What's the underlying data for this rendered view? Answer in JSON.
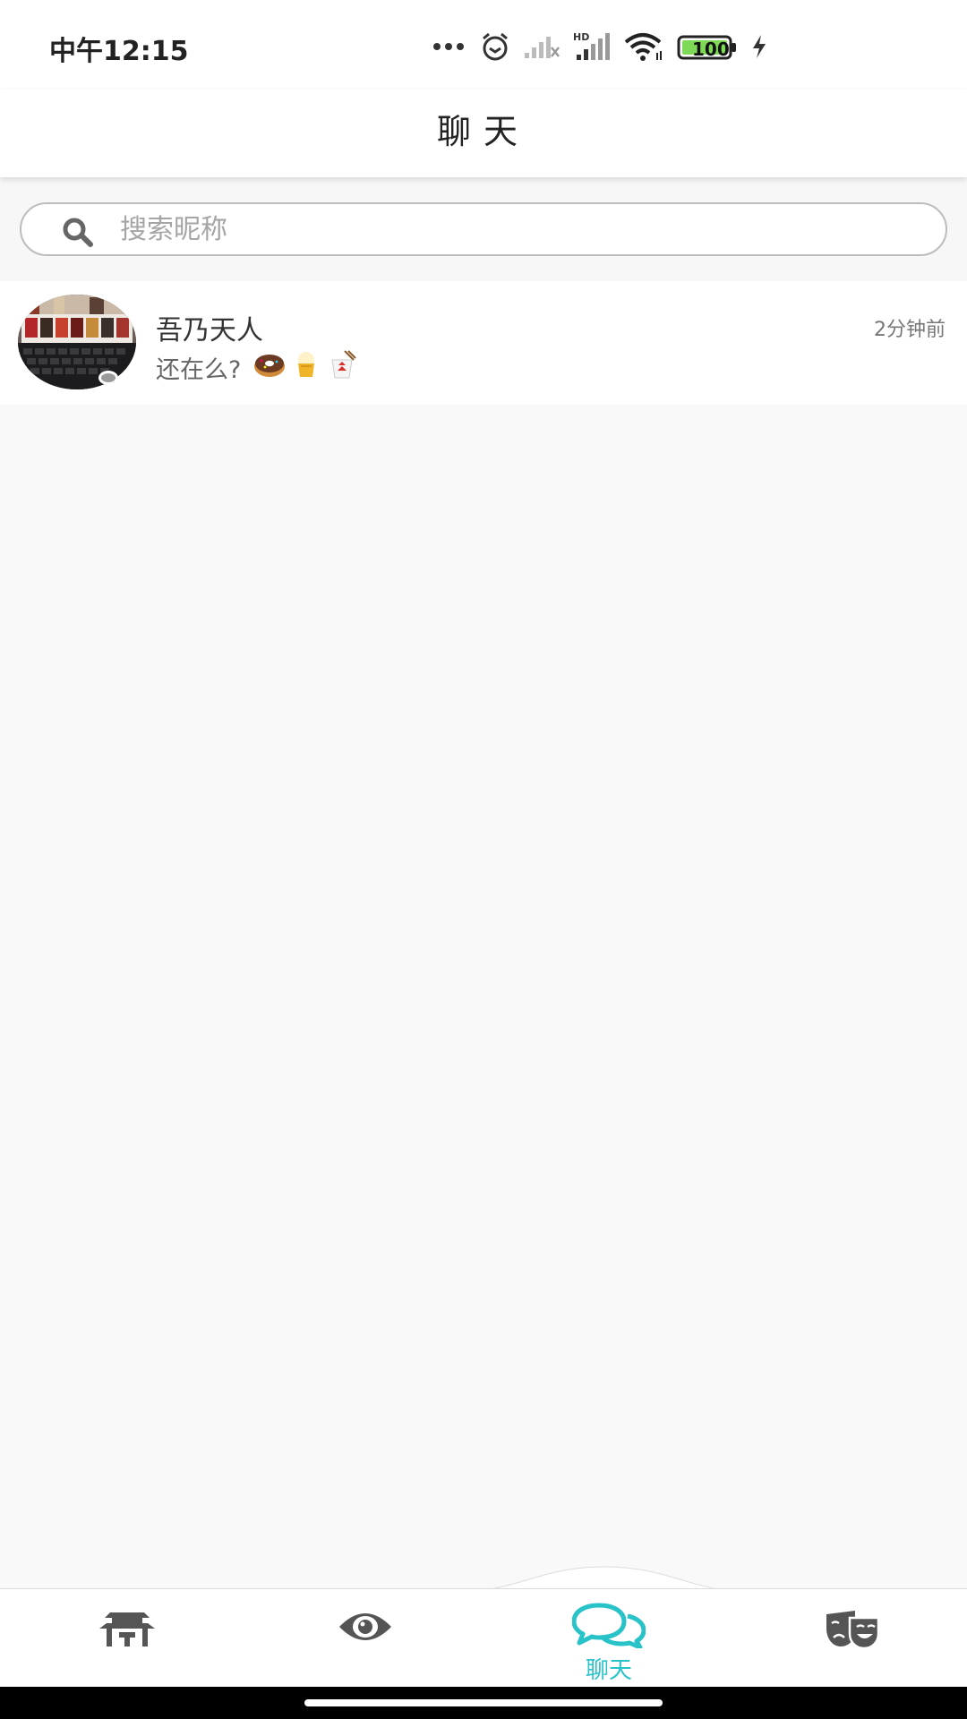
{
  "status_bar": {
    "time": "中午12:15",
    "battery": "100",
    "icons": [
      "more-dots-icon",
      "alarm-icon",
      "signal-empty-icon",
      "hd-signal-icon",
      "wifi-icon",
      "battery-icon",
      "charging-icon"
    ]
  },
  "header": {
    "title": "聊天"
  },
  "search": {
    "placeholder": "搜索昵称",
    "value": ""
  },
  "chats": [
    {
      "name": "吾乃天人",
      "time": "2分钟前",
      "preview": "还在么?",
      "emojis": [
        "donut-emoji",
        "ice-cream-emoji",
        "takeout-box-emoji"
      ]
    }
  ],
  "bottom_nav": {
    "items": [
      {
        "icon": "pagoda-icon",
        "label": "",
        "active": false
      },
      {
        "icon": "eye-icon",
        "label": "",
        "active": false
      },
      {
        "icon": "chat-bubbles-icon",
        "label": "聊天",
        "active": true
      },
      {
        "icon": "theater-masks-icon",
        "label": "",
        "active": false
      }
    ],
    "active_color": "#27c3c9",
    "inactive_color": "#555555"
  }
}
